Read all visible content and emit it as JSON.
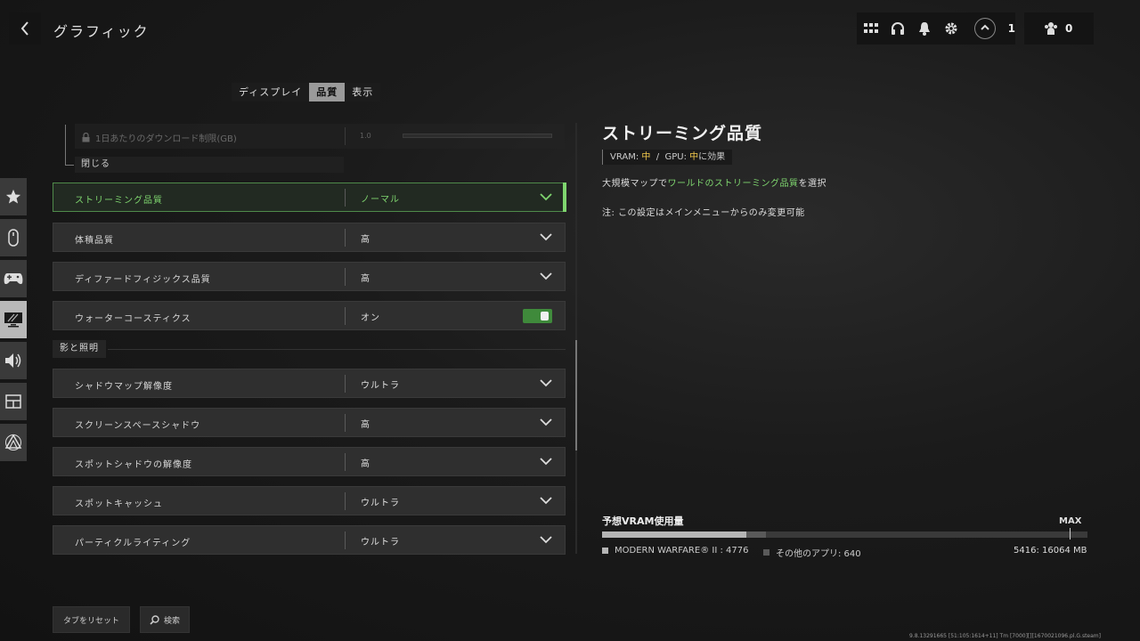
{
  "header": {
    "title": "グラフィック",
    "rank_count": "1",
    "party_count": "0"
  },
  "tabs": [
    {
      "label": "ディスプレイ"
    },
    {
      "label": "品質"
    },
    {
      "label": "表示"
    }
  ],
  "side_nav_icons": [
    "star-icon",
    "mouse-icon",
    "gamepad-icon",
    "monitor-icon",
    "speaker-icon",
    "interface-icon",
    "network-icon"
  ],
  "collapsed_section": {
    "download_limit_label": "1日あたりのダウンロード制限(GB)",
    "download_limit_value": "1.0",
    "close_label": "閉じる"
  },
  "settings": [
    {
      "label": "ストリーミング品質",
      "value": "ノーマル"
    },
    {
      "label": "体積品質",
      "value": "高"
    },
    {
      "label": "ディファードフィジックス品質",
      "value": "高"
    },
    {
      "label": "ウォーターコースティクス",
      "value": "オン"
    },
    {
      "label": "シャドウマップ解像度",
      "value": "ウルトラ"
    },
    {
      "label": "スクリーンスペースシャドウ",
      "value": "高"
    },
    {
      "label": "スポットシャドウの解像度",
      "value": "高"
    },
    {
      "label": "スポットキャッシュ",
      "value": "ウルトラ"
    },
    {
      "label": "パーティクルライティング",
      "value": "ウルトラ"
    }
  ],
  "section_shadow_label": "影と照明",
  "detail": {
    "title": "ストリーミング品質",
    "impact_vram_label": "VRAM:",
    "impact_vram_value": "中",
    "impact_separator": "/",
    "impact_gpu_label": "GPU:",
    "impact_gpu_value": "中",
    "impact_suffix": "に効果",
    "desc_prefix": "大規模マップで",
    "desc_highlight": "ワールドのストリーミング品質",
    "desc_suffix": "を選択",
    "note": "注: この設定はメインメニューからのみ変更可能"
  },
  "vram": {
    "title": "予想VRAM使用量",
    "max_label": "MAX",
    "mw_label": "MODERN WARFARE® II : 4776",
    "other_label": "その他のアプリ: 640",
    "total_label": "5416: 16064 MB",
    "mw_mb": 4776,
    "other_mb": 640,
    "total_mb": 16064,
    "colors": {
      "mw": "#b5b5b5",
      "other": "#5a5a5a"
    }
  },
  "footer": {
    "reset_label": "タブをリセット",
    "search_label": "検索",
    "build_info": "9.8.13291665 [51:105:1614+11] Tm [7000][][1670021096.pl.G.steam]"
  },
  "colors": {
    "accent_green": "#7fd66f",
    "impact_yellow": "#f2c94c"
  }
}
